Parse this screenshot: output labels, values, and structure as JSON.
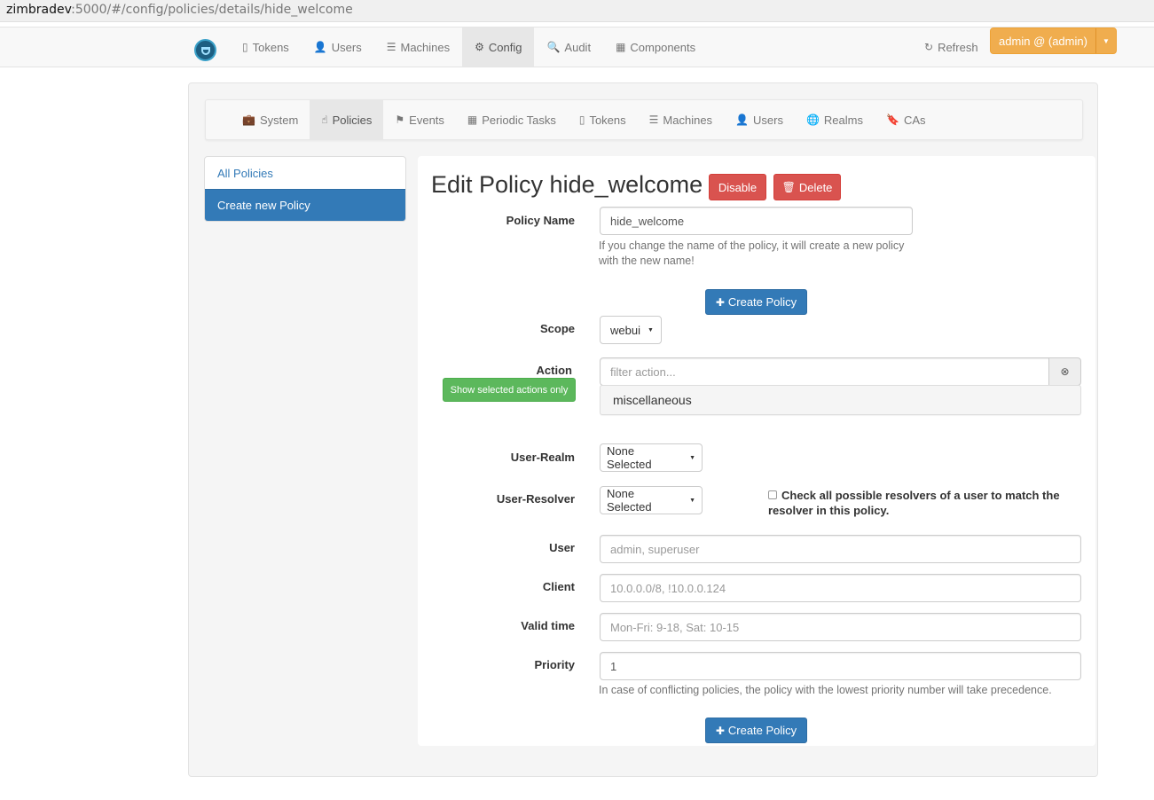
{
  "url": {
    "host": "zimbradev",
    "rest": ":5000/#/config/policies/details/hide_welcome"
  },
  "topnav": {
    "items": [
      {
        "icon": "mobile-icon",
        "label": "Tokens"
      },
      {
        "icon": "user-icon",
        "label": "Users"
      },
      {
        "icon": "server-icon",
        "label": "Machines"
      },
      {
        "icon": "gear-icon",
        "label": "Config",
        "active": true
      },
      {
        "icon": "search-icon",
        "label": "Audit"
      },
      {
        "icon": "table-icon",
        "label": "Components"
      }
    ],
    "refresh_label": "Refresh",
    "user_label": "admin @ (admin)"
  },
  "subnav": {
    "items": [
      {
        "icon": "briefcase-icon",
        "label": "System"
      },
      {
        "icon": "hand-icon",
        "label": "Policies",
        "active": true
      },
      {
        "icon": "flag-icon",
        "label": "Events"
      },
      {
        "icon": "calendar-icon",
        "label": "Periodic Tasks"
      },
      {
        "icon": "mobile-icon",
        "label": "Tokens"
      },
      {
        "icon": "server-icon",
        "label": "Machines"
      },
      {
        "icon": "user-icon",
        "label": "Users"
      },
      {
        "icon": "globe-icon",
        "label": "Realms"
      },
      {
        "icon": "bookmark-icon",
        "label": "CAs"
      }
    ]
  },
  "sidebar": {
    "items": [
      {
        "label": "All Policies"
      },
      {
        "label": "Create new Policy",
        "active": true
      }
    ]
  },
  "form": {
    "title": "Edit Policy hide_welcome",
    "disable_label": "Disable",
    "delete_label": "Delete",
    "policy_name_label": "Policy Name",
    "policy_name_value": "hide_welcome",
    "policy_name_help": "If you change the name of the policy, it will create a new policy with the new name!",
    "create_label": "Create Policy",
    "scope_label": "Scope",
    "scope_value": "webui",
    "action_label": "Action",
    "show_selected_label": "Show selected actions only",
    "action_filter_placeholder": "filter action...",
    "action_group": "miscellaneous",
    "user_realm_label": "User-Realm",
    "user_realm_value": "None Selected",
    "user_resolver_label": "User-Resolver",
    "user_resolver_value": "None Selected",
    "check_resolvers_label": "Check all possible resolvers of a user to match the resolver in this policy.",
    "user_label": "User",
    "user_placeholder": "admin, superuser",
    "client_label": "Client",
    "client_placeholder": "10.0.0.0/8, !10.0.0.124",
    "valid_time_label": "Valid time",
    "valid_time_placeholder": "Mon-Fri: 9-18, Sat: 10-15",
    "priority_label": "Priority",
    "priority_value": "1",
    "priority_help": "In case of conflicting policies, the policy with the lowest priority number will take precedence."
  }
}
